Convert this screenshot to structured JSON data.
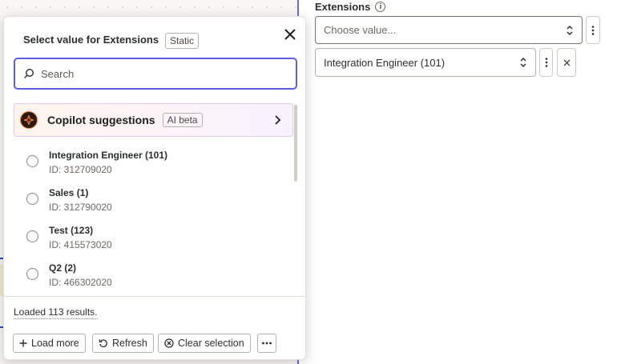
{
  "field": {
    "label": "Extensions"
  },
  "select_main": {
    "placeholder": "Choose value..."
  },
  "select_value": {
    "value": "Integration Engineer (101)"
  },
  "popover": {
    "title": "Select value for Extensions",
    "badge": "Static",
    "search_placeholder": "Search",
    "copilot": {
      "title": "Copilot suggestions",
      "badge": "AI beta"
    },
    "options": [
      {
        "label": "Integration Engineer (101)",
        "id": "ID: 312709020"
      },
      {
        "label": "Sales (1)",
        "id": "ID: 312790020"
      },
      {
        "label": "Test (123)",
        "id": "ID: 415573020"
      },
      {
        "label": "Q2 (2)",
        "id": "ID: 466302020"
      }
    ],
    "status": "Loaded 113 results.",
    "buttons": {
      "load_more": "Load more",
      "refresh": "Refresh",
      "clear": "Clear selection"
    }
  },
  "colors": {
    "accent": "#5d5de0",
    "divider": "#3f3fb5",
    "copilot_border": "#e4c7ec"
  },
  "icons": [
    "info-icon",
    "chevron-updown-icon",
    "more-vertical-icon",
    "close-icon",
    "search-icon",
    "copilot-logo-icon",
    "chevron-right-icon",
    "plus-icon",
    "refresh-icon",
    "clear-icon",
    "more-horizontal-icon"
  ]
}
